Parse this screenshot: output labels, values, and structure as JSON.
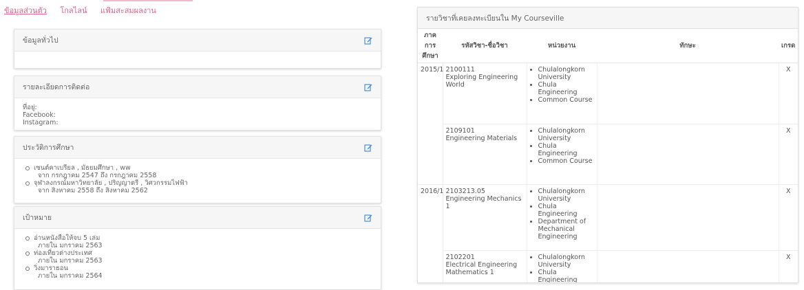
{
  "tabs": [
    "ข้อมูลส่วนตัว",
    "โกลไลน์",
    "แฟ้มสะสมผลงาน"
  ],
  "cards": [
    {
      "title": "ข้อมูลทั่วไป"
    },
    {
      "title": "รายละเอียดการติดต่อ",
      "lines": [
        "ที่อยู่:",
        "Facebook:",
        "Instagram:"
      ]
    },
    {
      "title": "ประวัติการศึกษา",
      "items": [
        {
          "line1": "เซนต์คาเบรียล , มัธยมศึกษา , ww",
          "line2": "จาก กรกฎาคม 2547 ถึง กรกฎาคม 2558"
        },
        {
          "line1": "จุฬาลงกรณ์มหาวิทยาลัย , ปริญญาตรี , วิศวกรรมไฟฟ้า",
          "line2": "จาก สิงหาคม 2558 ถึง สิงหาคม 2562"
        }
      ]
    },
    {
      "title": "เป้าหมาย",
      "items": [
        {
          "line1": "อ่านหนังสือให้จบ 5 เล่ม",
          "line2": "ภายใน มกราคม 2563"
        },
        {
          "line1": "ท่องเที่ยวต่างประเทศ",
          "line2": "ภายใน มกราคม 2563"
        },
        {
          "line1": "วิ่งมาราธอน",
          "line2": "ภายใน มกราคม 2564"
        }
      ]
    }
  ],
  "courses": {
    "title": "รายวิชาที่เคยลงทะเบียนใน My Courseville",
    "headers": {
      "term": "ภาคการ ศึกษา",
      "code": "รหัสวิชา-ชื่อวิชา",
      "dept": "หน่วยงาน",
      "skill": "ทักษะ",
      "grade": "เกรด"
    },
    "rows": [
      {
        "term": "2015/1",
        "code": "2100111",
        "name": "Exploring Engineering World",
        "depts": [
          "Chulalongkorn University",
          "Chula Engineering",
          "Common Course"
        ],
        "grade": "X"
      },
      {
        "term": "",
        "code": "2109101",
        "name": "Engineering Materials",
        "depts": [
          "Chulalongkorn University",
          "Chula Engineering",
          "Common Course"
        ],
        "grade": "X"
      },
      {
        "term": "2016/1",
        "code": "2103213.05",
        "name": "Engineering Mechanics 1",
        "depts": [
          "Chulalongkorn University",
          "Chula Engineering",
          "Department of Mechanical Engineering"
        ],
        "grade": "X"
      },
      {
        "term": "",
        "code": "2102201",
        "name": "Electrical Engineering Mathematics 1",
        "depts": [
          "Chulalongkorn University",
          "Chula Engineering"
        ],
        "grade": "X"
      }
    ]
  }
}
